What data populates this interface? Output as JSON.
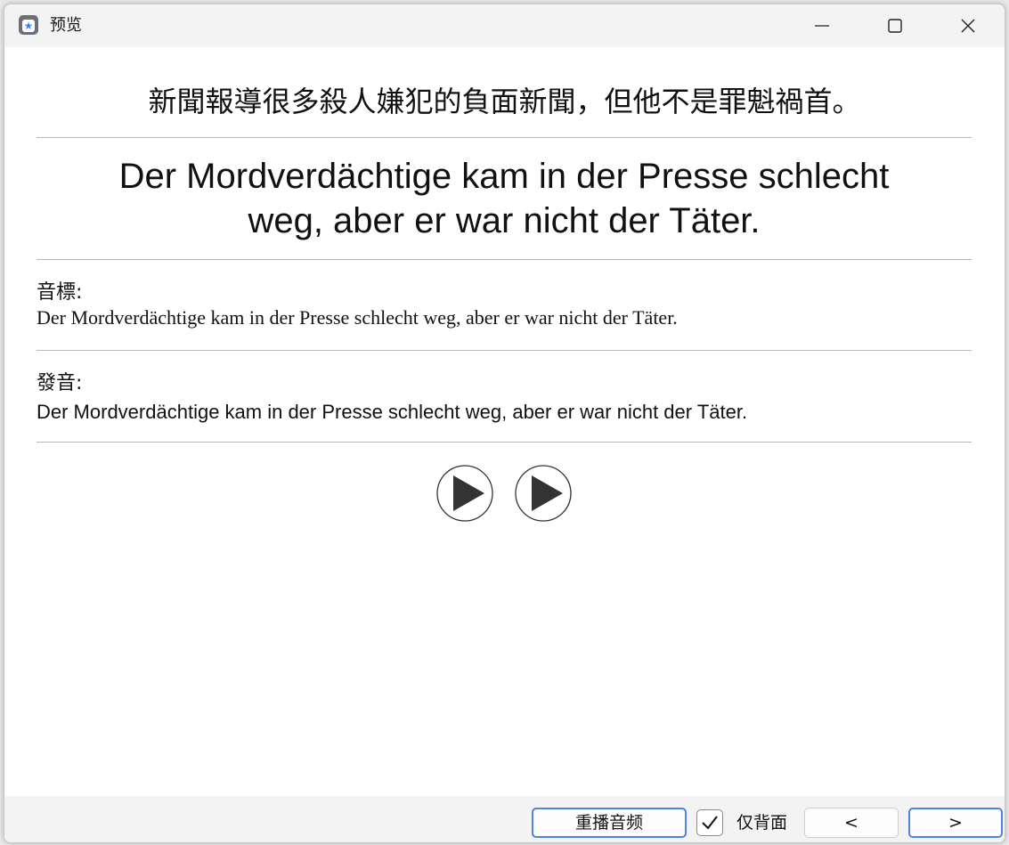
{
  "window": {
    "title": "预览"
  },
  "card": {
    "front": "新聞報導很多殺人嫌犯的負面新聞，但他不是罪魁禍首。",
    "back_line1": "Der Mordverdächtige kam in der Presse schlecht",
    "back_line2": "weg, aber er war nicht der Täter.",
    "phonetic_label": "音標:",
    "phonetic_text": "Der Mordverdächtige kam in der Presse schlecht weg, aber er war nicht der Täter.",
    "pronunciation_label": "發音:",
    "pronunciation_text": "Der Mordverdächtige kam in der Presse schlecht weg, aber er war nicht der Täter."
  },
  "icons": {
    "app": "app-icon",
    "minimize": "minimize-icon",
    "maximize": "maximize-icon",
    "close": "close-icon",
    "play": "play-icon",
    "check": "check-icon"
  },
  "footer": {
    "replay_label": "重播音频",
    "back_only_label": "仅背面",
    "back_only_checked": true,
    "prev_label": "<",
    "next_label": ">"
  },
  "colors": {
    "accent": "#4f83e0",
    "divider": "#b8b8b8",
    "titlebar": "#f3f3f3"
  }
}
